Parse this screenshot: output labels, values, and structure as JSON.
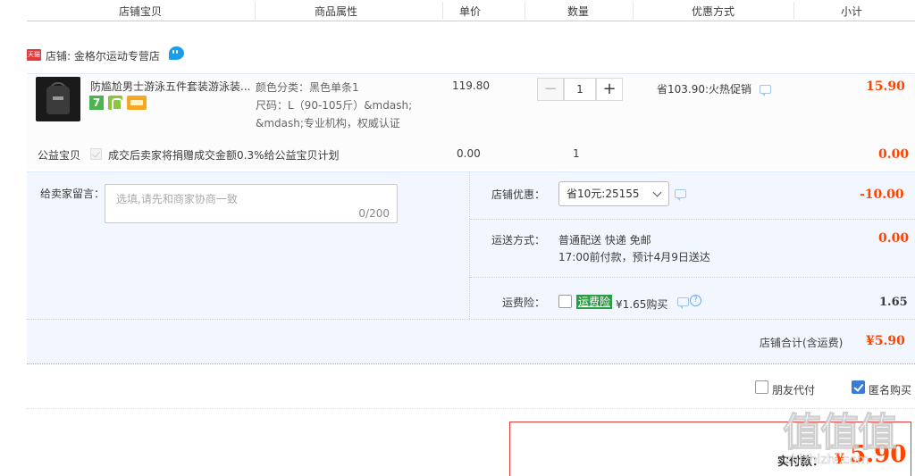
{
  "header": {
    "col_item": "店铺宝贝",
    "col_attr": "商品属性",
    "col_price": "单价",
    "col_qty": "数量",
    "col_discount": "优惠方式",
    "col_subtotal": "小计"
  },
  "shop": {
    "badge": "天猫",
    "name": "店铺: 金格尔运动专营店"
  },
  "item": {
    "title": "防尴尬男士游泳五件套装游泳装...",
    "attr_color": "颜色分类：黑色单条1",
    "attr_size_1": "尺码：L（90-105斤）&mdash;",
    "attr_size_2": "&mdash;专业机构，权威认证",
    "price": "119.80",
    "qty": "1",
    "qty_minus": "−",
    "qty_plus": "+",
    "discount": "省103.90:火热促销",
    "subtotal": "15.90",
    "svc_badge": "7"
  },
  "charity": {
    "label": "公益宝贝",
    "desc": "成交后卖家将捐赠成交金额0.3%给公益宝贝计划",
    "price": "0.00",
    "qty": "1",
    "subtotal": "0.00"
  },
  "memo": {
    "label": "给卖家留言：",
    "placeholder": "选填,请先和商家协商一致",
    "count": "0/200"
  },
  "coupon": {
    "label": "店铺优惠：",
    "selected": "省10元:25155",
    "amount": "-10.00"
  },
  "shipping": {
    "label": "运送方式：",
    "method": "普通配送 快递 免邮",
    "eta": "17:00前付款，预计4月9日送达",
    "amount": "0.00"
  },
  "insurance": {
    "label": "运费险：",
    "tag": "运费险",
    "price": "¥1.65购买",
    "amount": "1.65",
    "help": "?"
  },
  "shop_total": {
    "label": "店铺合计(含运费)",
    "amount": "¥5.90"
  },
  "options": {
    "friend_pay": "朋友代付",
    "anonymous": "匿名购买"
  },
  "pay": {
    "label": "实付款：",
    "currency": "¥",
    "amount": "5.90"
  },
  "watermark": {
    "text": "值值值",
    "url": "zhizhizhi.com"
  }
}
